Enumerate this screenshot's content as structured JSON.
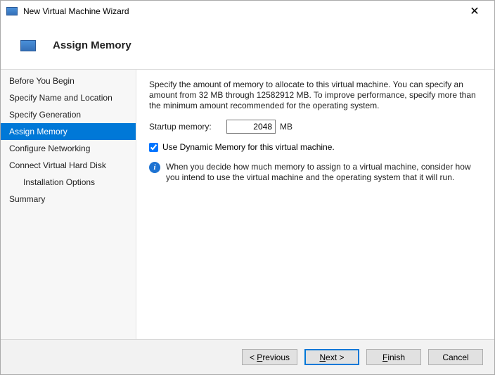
{
  "window": {
    "title": "New Virtual Machine Wizard",
    "close_glyph": "✕"
  },
  "header": {
    "page_title": "Assign Memory"
  },
  "sidebar": {
    "items": [
      {
        "label": "Before You Begin",
        "active": false,
        "indent": false
      },
      {
        "label": "Specify Name and Location",
        "active": false,
        "indent": false
      },
      {
        "label": "Specify Generation",
        "active": false,
        "indent": false
      },
      {
        "label": "Assign Memory",
        "active": true,
        "indent": false
      },
      {
        "label": "Configure Networking",
        "active": false,
        "indent": false
      },
      {
        "label": "Connect Virtual Hard Disk",
        "active": false,
        "indent": false
      },
      {
        "label": "Installation Options",
        "active": false,
        "indent": true
      },
      {
        "label": "Summary",
        "active": false,
        "indent": false
      }
    ]
  },
  "content": {
    "description": "Specify the amount of memory to allocate to this virtual machine. You can specify an amount from 32 MB through 12582912 MB. To improve performance, specify more than the minimum amount recommended for the operating system.",
    "startup_memory_label": "Startup memory:",
    "startup_memory_value": "2048",
    "startup_memory_unit": "MB",
    "dynamic_memory_checked": true,
    "dynamic_memory_label": "Use Dynamic Memory for this virtual machine.",
    "info_text": "When you decide how much memory to assign to a virtual machine, consider how you intend to use the virtual machine and the operating system that it will run."
  },
  "footer": {
    "previous": "< Previous",
    "finish": "Finish",
    "cancel": "Cancel"
  }
}
